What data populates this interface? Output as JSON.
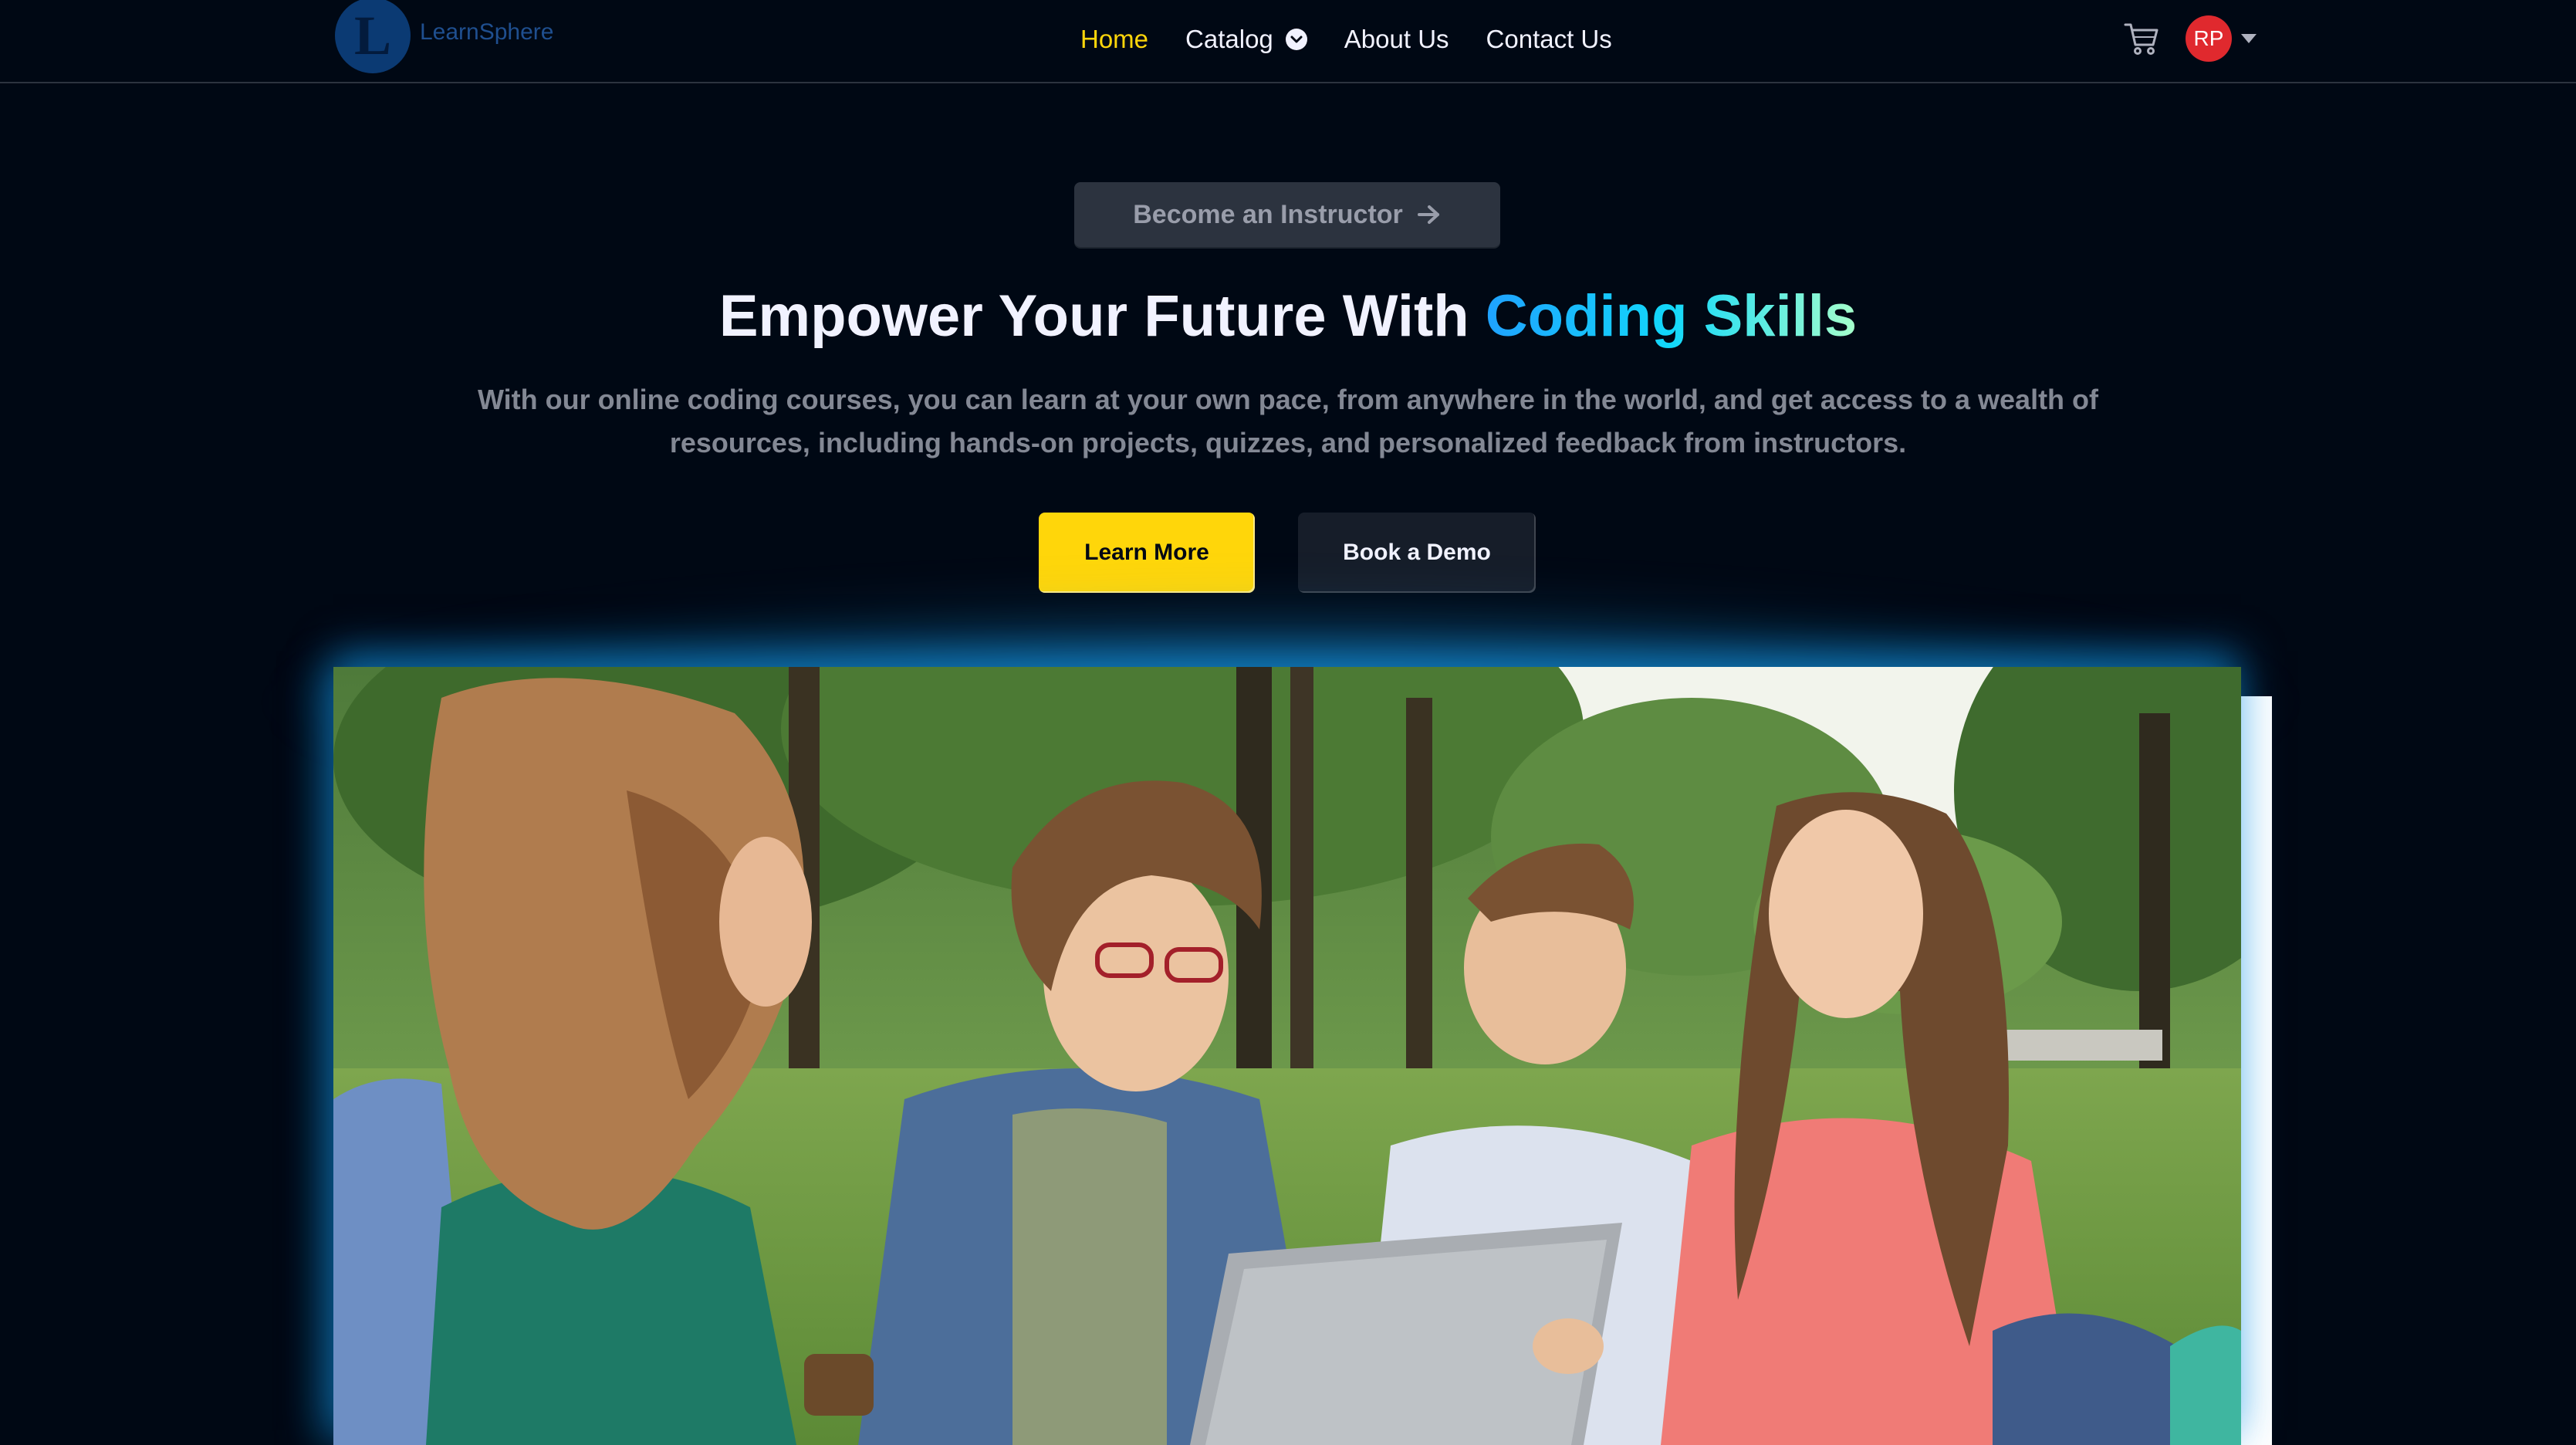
{
  "brand": {
    "logo_letter": "L",
    "name": "LearnSphere"
  },
  "nav": {
    "items": [
      {
        "label": "Home",
        "active": true
      },
      {
        "label": "Catalog",
        "has_dropdown": true
      },
      {
        "label": "About Us"
      },
      {
        "label": "Contact Us"
      }
    ],
    "cart_icon": "shopping-cart-icon",
    "avatar_initials": "RP",
    "avatar_color": "#E0292E"
  },
  "hero": {
    "instructor_button": "Become an Instructor",
    "title_prefix": "Empower Your Future With ",
    "title_highlight": "Coding Skills",
    "subtitle": "With our online coding courses, you can learn at your own pace, from anywhere in the world, and get access to a wealth of resources, including hands-on projects, quizzes, and personalized feedback from instructors.",
    "primary_button": "Learn More",
    "secondary_button": "Book a Demo"
  },
  "colors": {
    "background": "#000814",
    "accent_yellow": "#FFD60A",
    "highlight_gradient": [
      "#1FA2FF",
      "#12D8FA",
      "#A6FFCB"
    ],
    "button_dark": "#2C333F",
    "text_muted": "#838894"
  }
}
